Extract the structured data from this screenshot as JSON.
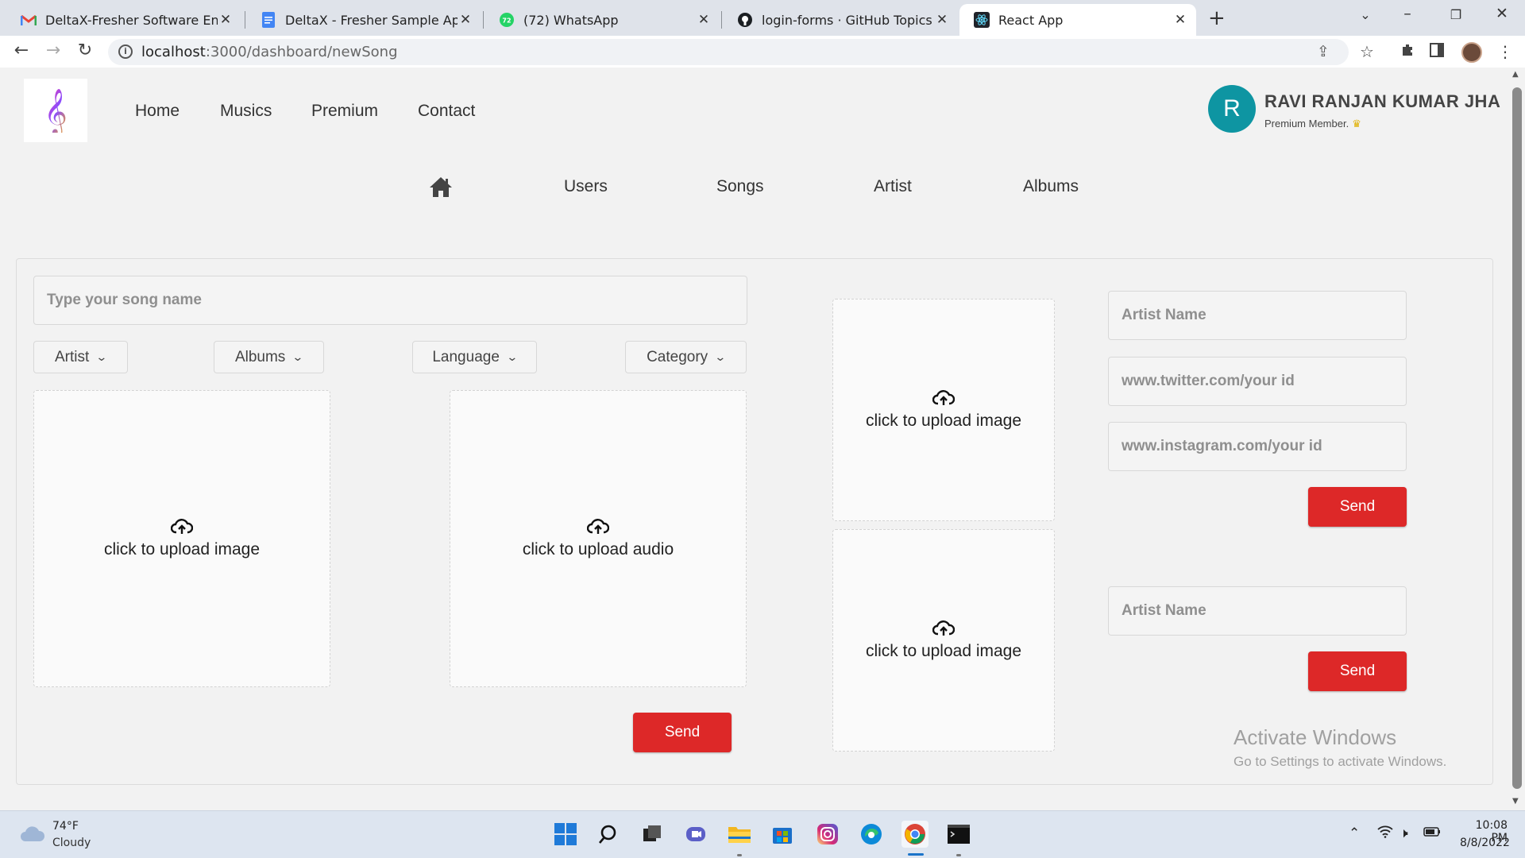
{
  "browser": {
    "tabs": [
      {
        "title": "DeltaX-Fresher Software Enginee",
        "icon": "gmail-icon"
      },
      {
        "title": "DeltaX - Fresher Sample App - Sp",
        "icon": "google-docs-icon"
      },
      {
        "title": "(72) WhatsApp",
        "icon": "whatsapp-icon",
        "badge": "72"
      },
      {
        "title": "login-forms · GitHub Topics",
        "icon": "github-icon"
      },
      {
        "title": "React App",
        "icon": "react-icon",
        "active": true
      }
    ],
    "url_host": "localhost",
    "url_rest": ":3000/dashboard/newSong"
  },
  "header": {
    "nav": [
      "Home",
      "Musics",
      "Premium",
      "Contact"
    ],
    "avatar_letter": "R",
    "username": "RAVI RANJAN KUMAR JHA",
    "membership": "Premium Member.",
    "accent": "#0e95a2"
  },
  "subnav": [
    "Users",
    "Songs",
    "Artist",
    "Albums"
  ],
  "song_form": {
    "song_name_placeholder": "Type your song name",
    "dropdowns": [
      "Artist",
      "Albums",
      "Language",
      "Category"
    ],
    "upload_image_label": "click to upload image",
    "upload_audio_label": "click to upload audio",
    "send_label": "Send"
  },
  "middle_uploads": {
    "top_label": "click to upload image",
    "bottom_label": "click to upload image"
  },
  "artist_form": {
    "artist_name_placeholder": "Artist Name",
    "twitter_placeholder": "www.twitter.com/your id",
    "instagram_placeholder": "www.instagram.com/your id",
    "send_label": "Send"
  },
  "album_form": {
    "artist_name_placeholder": "Artist Name",
    "send_label": "Send"
  },
  "button_color": "#dd2828",
  "watermark": {
    "line1": "Activate Windows",
    "line2": "Go to Settings to activate Windows."
  },
  "taskbar": {
    "temperature": "74°F",
    "condition": "Cloudy",
    "time": "10:08 PM",
    "date": "8/8/2022"
  }
}
